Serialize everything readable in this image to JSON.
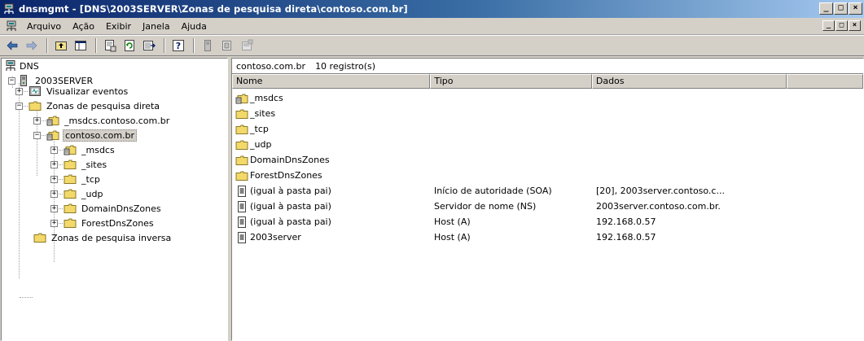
{
  "window": {
    "title": "dnsmgmt - [DNS\\2003SERVER\\Zonas de pesquisa direta\\contoso.com.br]",
    "minimize": "_",
    "maximize": "□",
    "close": "×"
  },
  "menu": [
    {
      "label": "Arquivo"
    },
    {
      "label": "Ação"
    },
    {
      "label": "Exibir"
    },
    {
      "label": "Janela"
    },
    {
      "label": "Ajuda"
    }
  ],
  "toolbar_icons": [
    "back-icon",
    "forward-icon",
    "up-folder-icon",
    "show-hide-tree-icon",
    "properties-icon",
    "refresh-icon",
    "export-list-icon",
    "help-icon",
    "server-icon",
    "record-icon",
    "dns-wizard-icon"
  ],
  "tree": {
    "root": "DNS",
    "server": "2003SERVER",
    "event_viewer": "Visualizar eventos",
    "forward_zones": "Zonas de pesquisa direta",
    "msdcs_zone": "_msdcs.contoso.com.br",
    "contoso_zone": "contoso.com.br",
    "children": [
      "_msdcs",
      "_sites",
      "_tcp",
      "_udp",
      "DomainDnsZones",
      "ForestDnsZones"
    ],
    "reverse_zones": "Zonas de pesquisa inversa"
  },
  "details": {
    "zone_name": "contoso.com.br",
    "record_count": "10 registro(s)",
    "columns": [
      "Nome",
      "Tipo",
      "Dados"
    ],
    "rows": [
      {
        "name": "_msdcs",
        "type": "",
        "data": "",
        "icon": "delegated-folder"
      },
      {
        "name": "_sites",
        "type": "",
        "data": "",
        "icon": "folder"
      },
      {
        "name": "_tcp",
        "type": "",
        "data": "",
        "icon": "folder"
      },
      {
        "name": "_udp",
        "type": "",
        "data": "",
        "icon": "folder"
      },
      {
        "name": "DomainDnsZones",
        "type": "",
        "data": "",
        "icon": "folder"
      },
      {
        "name": "ForestDnsZones",
        "type": "",
        "data": "",
        "icon": "folder"
      },
      {
        "name": "(igual à pasta pai)",
        "type": "Início de autoridade (SOA)",
        "data": "[20], 2003server.contoso.c...",
        "icon": "record"
      },
      {
        "name": "(igual à pasta pai)",
        "type": "Servidor de nome (NS)",
        "data": "2003server.contoso.com.br.",
        "icon": "record"
      },
      {
        "name": "(igual à pasta pai)",
        "type": "Host (A)",
        "data": "192.168.0.57",
        "icon": "record"
      },
      {
        "name": "2003server",
        "type": "Host (A)",
        "data": "192.168.0.57",
        "icon": "record"
      }
    ]
  }
}
